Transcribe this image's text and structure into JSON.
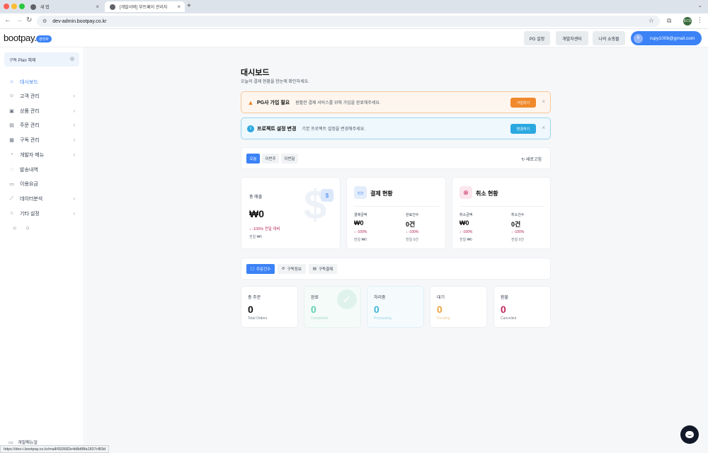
{
  "browser": {
    "tabs": [
      {
        "label": "새 탭",
        "active": false
      },
      {
        "label": "[개발서버] 부트페이 관리자",
        "active": true
      }
    ],
    "url": "dev-admin.bootpay.co.kr",
    "new_tab": "+",
    "profile_initials": "ECS",
    "status_url": "https://dev-i.bootpay.co.kr/mall/692682e4d8df8fa1837cf83d"
  },
  "header": {
    "logo_text": "bootpay.",
    "logo_badge": "관리자",
    "buttons": {
      "pg_settings": "PG 설정",
      "dev_center": "개발자센터",
      "my_stores": "나의 쇼핑몰"
    },
    "user": {
      "avatar": "R",
      "email": "rupy1008@gmail.com"
    }
  },
  "sidebar": {
    "plan_label": "구독 Plan 해제",
    "items": [
      {
        "label": "대시보드",
        "icon": "home-icon",
        "glyph": "⌂",
        "chevron": false,
        "active": true
      },
      {
        "label": "고객 관리",
        "icon": "users-icon",
        "glyph": "☺",
        "chevron": true
      },
      {
        "label": "상품 관리",
        "icon": "box-icon",
        "glyph": "▣",
        "chevron": true
      },
      {
        "label": "주문 관리",
        "icon": "order-icon",
        "glyph": "▤",
        "chevron": true
      },
      {
        "label": "구독 관리",
        "icon": "subscription-icon",
        "glyph": "▦",
        "chevron": true
      },
      {
        "label": "개발자 메뉴",
        "icon": "clock-icon",
        "glyph": "◔",
        "chevron": true
      },
      {
        "label": "발송내역",
        "icon": "message-icon",
        "glyph": "◌",
        "chevron": false
      },
      {
        "label": "이용요금",
        "icon": "card-icon",
        "glyph": "▭",
        "chevron": false
      },
      {
        "label": "데이터분석",
        "icon": "chart-icon",
        "glyph": "⟋",
        "chevron": true
      },
      {
        "label": "기타 설정",
        "icon": "settings-icon",
        "glyph": "○",
        "chevron": true
      }
    ],
    "dev_manual": "개발매뉴얼"
  },
  "main": {
    "title": "대시보드",
    "subtitle": "오늘의 결제 현황을 한눈에 확인하세요.",
    "alerts": [
      {
        "title": "PG사 가입 필요",
        "desc": "원활한 결제 서비스를 위해 가입을 완료해주세요.",
        "button": "가입하기",
        "color": "#f0892c"
      },
      {
        "title": "프로젝트 설정 변경",
        "desc": "기본 프로젝트 설정을 변경해주세요.",
        "button": "변경하기",
        "color": "#2ba8e0"
      }
    ],
    "period_tabs": [
      "오늘",
      "이번주",
      "이번달"
    ],
    "refresh": "새로고침",
    "sales": {
      "label": "총 매출",
      "value": "₩0",
      "change": "↓ -100% 전일 대비",
      "prev": "전일 ₩0",
      "icon_glyph": "$"
    },
    "payment": {
      "title": "결제 현황",
      "amount_label": "결제금액",
      "amount": "₩0",
      "amount_change": "↓ -100%",
      "amount_prev": "전일 ₩0",
      "count_label": "완료건수",
      "count": "0건",
      "count_change": "↓ -100%",
      "count_prev": "전일 0건"
    },
    "cancel": {
      "title": "취소 현황",
      "amount_label": "취소금액",
      "amount": "₩0",
      "amount_change": "↓ -100%",
      "amount_prev": "전일 ₩0",
      "count_label": "취소건수",
      "count": "0건",
      "count_change": "↓ -100%",
      "count_prev": "전일 0건"
    },
    "order_tabs": [
      {
        "label": "주문건수",
        "glyph": "▢"
      },
      {
        "label": "구독정보",
        "glyph": "⟳"
      },
      {
        "label": "구독결제",
        "glyph": "▤"
      }
    ],
    "order_stats": [
      {
        "label": "총 주문",
        "value": "0",
        "sub": "Total Orders",
        "color": "#111111"
      },
      {
        "label": "완료",
        "value": "0",
        "sub": "Completed",
        "color": "#5ed0b3"
      },
      {
        "label": "처리중",
        "value": "0",
        "sub": "Processing",
        "color": "#3fb6d8"
      },
      {
        "label": "대기",
        "value": "0",
        "sub": "Pending",
        "color": "#e9a33a"
      },
      {
        "label": "환불",
        "value": "0",
        "sub": "Cancelled",
        "color": "#c3245f"
      }
    ]
  },
  "colors": {
    "accent": "#3b82f6",
    "negative": "#b4235a"
  }
}
